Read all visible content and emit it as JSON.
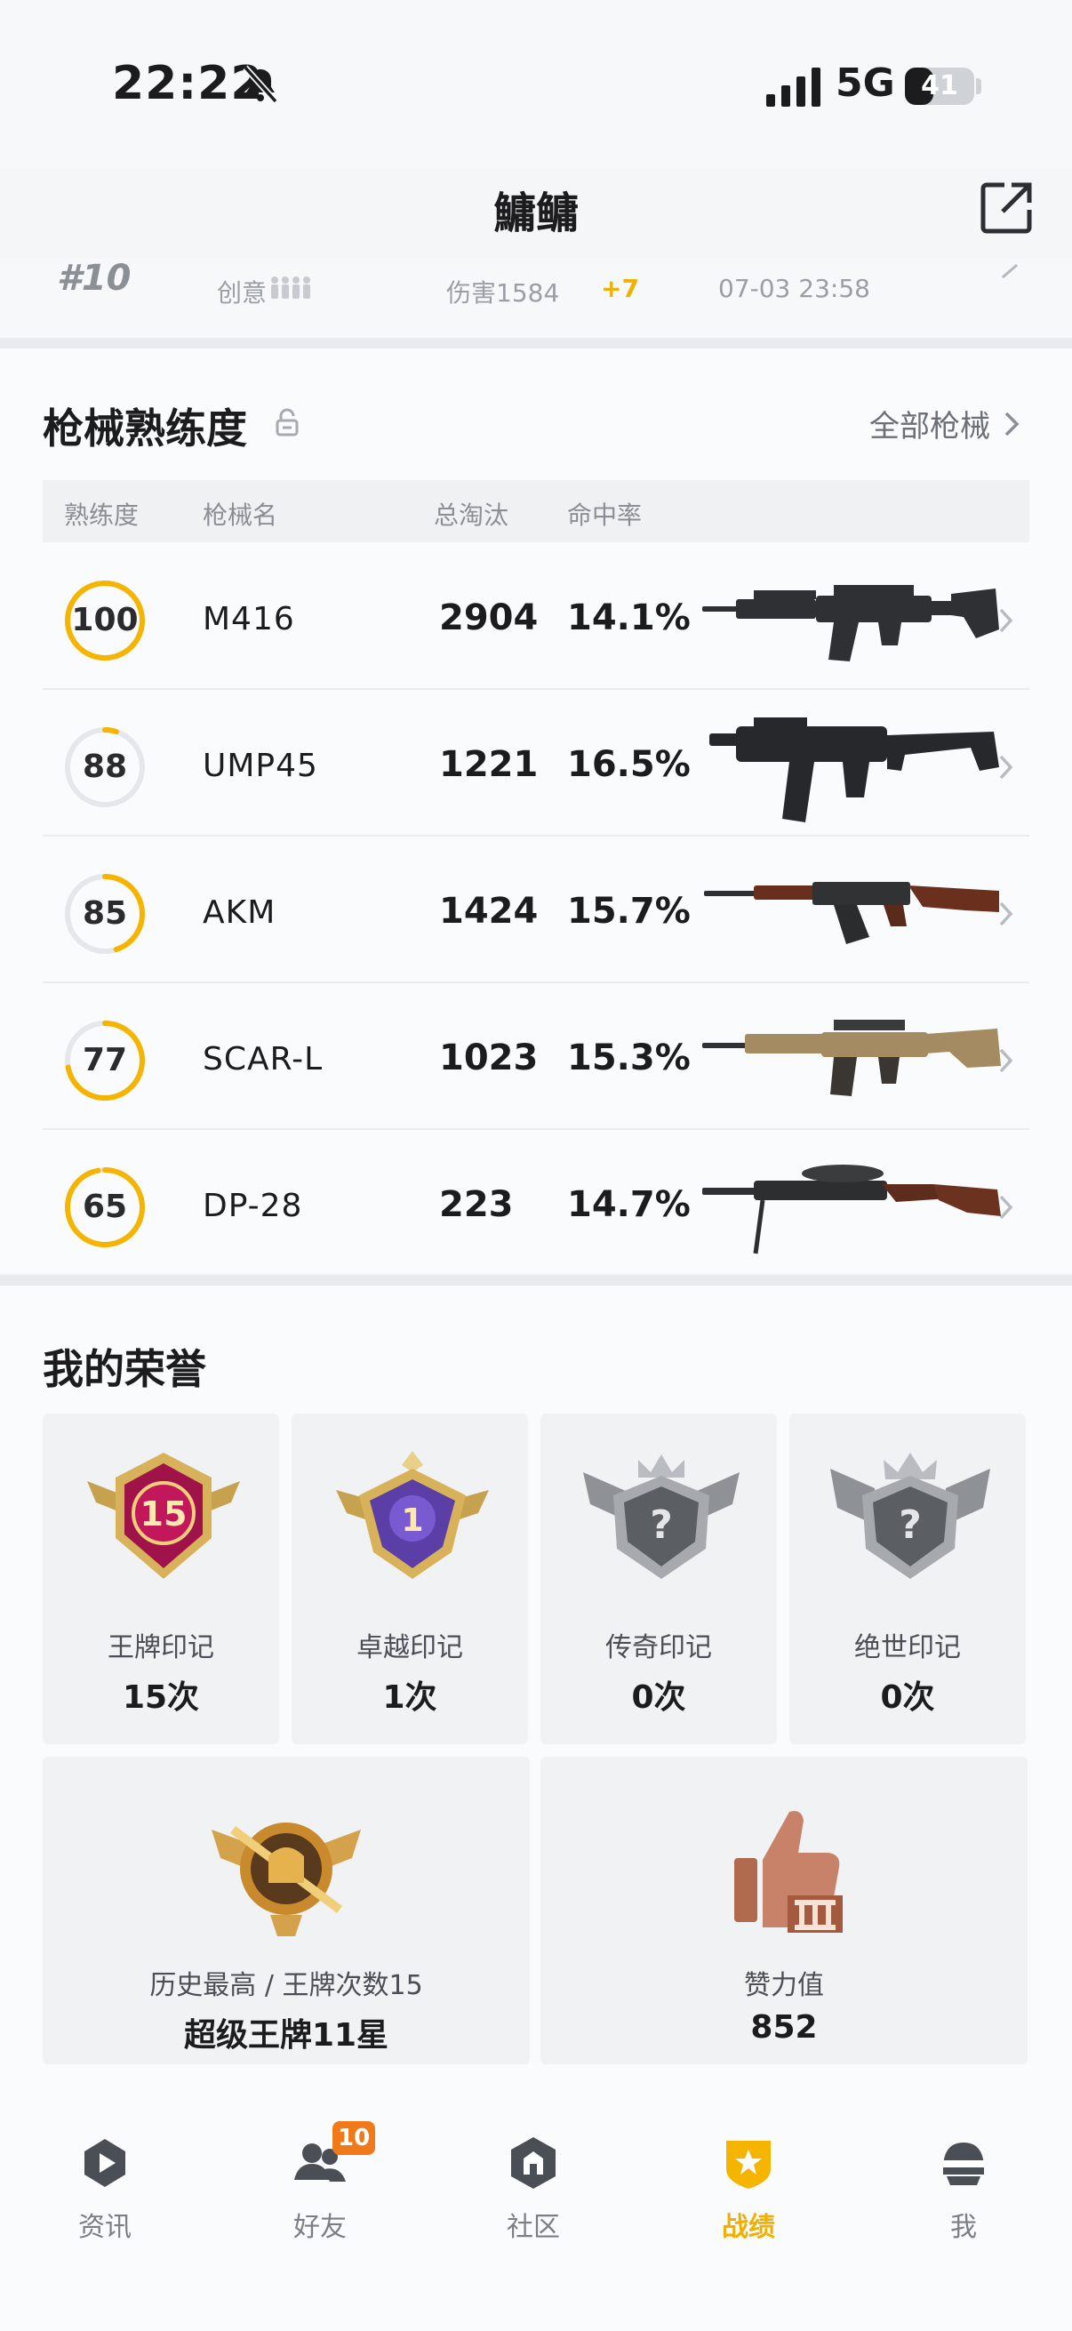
{
  "status_bar": {
    "time": "22:22",
    "network": "5G",
    "battery": "41"
  },
  "header": {
    "title": "鱅鳙"
  },
  "last_match": {
    "rank": "#10",
    "mode": "创意",
    "damage": "伤害1584",
    "delta": "+7",
    "time": "07-03 23:58"
  },
  "weapons": {
    "title": "枪械熟练度",
    "all_label": "全部枪械",
    "columns": {
      "mastery": "熟练度",
      "name": "枪械名",
      "kills": "总淘汰",
      "accuracy": "命中率"
    },
    "rows": [
      {
        "mastery": "100",
        "progress": 1.0,
        "name": "M416",
        "kills": "2904",
        "accuracy": "14.1%"
      },
      {
        "mastery": "88",
        "progress": 0.05,
        "name": "UMP45",
        "kills": "1221",
        "accuracy": "16.5%"
      },
      {
        "mastery": "85",
        "progress": 0.45,
        "name": "AKM",
        "kills": "1424",
        "accuracy": "15.7%"
      },
      {
        "mastery": "77",
        "progress": 0.72,
        "name": "SCAR-L",
        "kills": "1023",
        "accuracy": "15.3%"
      },
      {
        "mastery": "65",
        "progress": 0.97,
        "name": "DP-28",
        "kills": "223",
        "accuracy": "14.7%"
      }
    ]
  },
  "honors": {
    "title": "我的荣誉",
    "badges": [
      {
        "label": "王牌印记",
        "count": "15次",
        "badge_text": "15"
      },
      {
        "label": "卓越印记",
        "count": "1次",
        "badge_text": "1"
      },
      {
        "label": "传奇印记",
        "count": "0次",
        "badge_text": "?"
      },
      {
        "label": "绝世印记",
        "count": "0次",
        "badge_text": "?"
      }
    ],
    "peak": {
      "label": "历史最高 / 王牌次数15",
      "value": "超级王牌11星"
    },
    "likes": {
      "label": "赞力值",
      "value": "852"
    }
  },
  "tabbar": {
    "friend_badge": "10",
    "tabs": [
      {
        "label": "资讯",
        "icon": "news-icon"
      },
      {
        "label": "好友",
        "icon": "friends-icon"
      },
      {
        "label": "社区",
        "icon": "community-icon"
      },
      {
        "label": "战绩",
        "icon": "record-icon",
        "active": true
      },
      {
        "label": "我",
        "icon": "profile-icon"
      }
    ]
  },
  "colors": {
    "accent": "#f4b400",
    "ring_track": "#e6e7ea",
    "friend_badge": "#f07a1a"
  }
}
